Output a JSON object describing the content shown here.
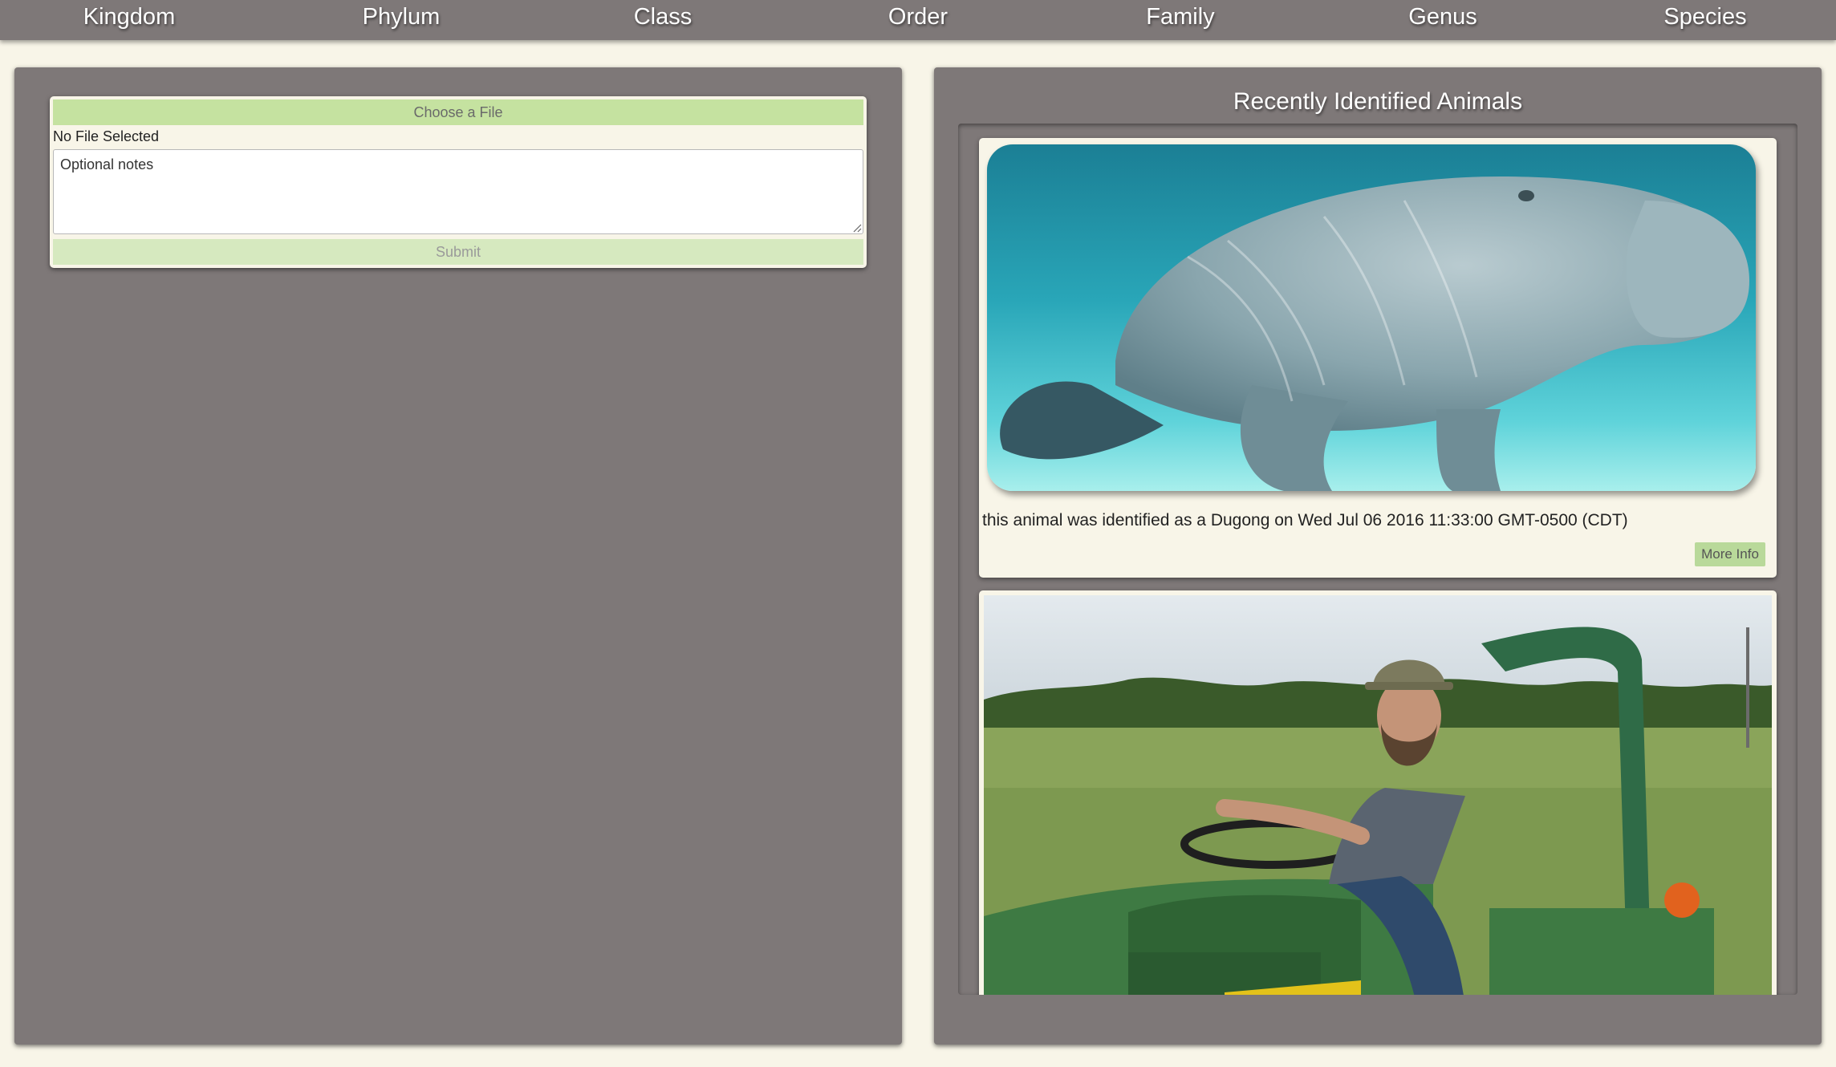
{
  "nav": {
    "items": [
      {
        "label": "Kingdom"
      },
      {
        "label": "Phylum"
      },
      {
        "label": "Class"
      },
      {
        "label": "Order"
      },
      {
        "label": "Family"
      },
      {
        "label": "Genus"
      },
      {
        "label": "Species"
      }
    ]
  },
  "upload": {
    "choose_label": "Choose a File",
    "file_status": "No File Selected",
    "notes_placeholder": "Optional notes",
    "notes_value": "",
    "submit_label": "Submit"
  },
  "recent": {
    "title": "Recently Identified Animals",
    "cards": [
      {
        "caption": "this animal was identified as a Dugong on Wed Jul 06 2016 11:33:00 GMT-0500 (CDT)",
        "button_label": "More Info"
      },
      {
        "caption": "",
        "button_label": ""
      }
    ]
  },
  "colors": {
    "background": "#f8f5e8",
    "panel": "#7e7878",
    "accent_green": "#c5e2a0",
    "submit_green": "#d6e9bf"
  }
}
